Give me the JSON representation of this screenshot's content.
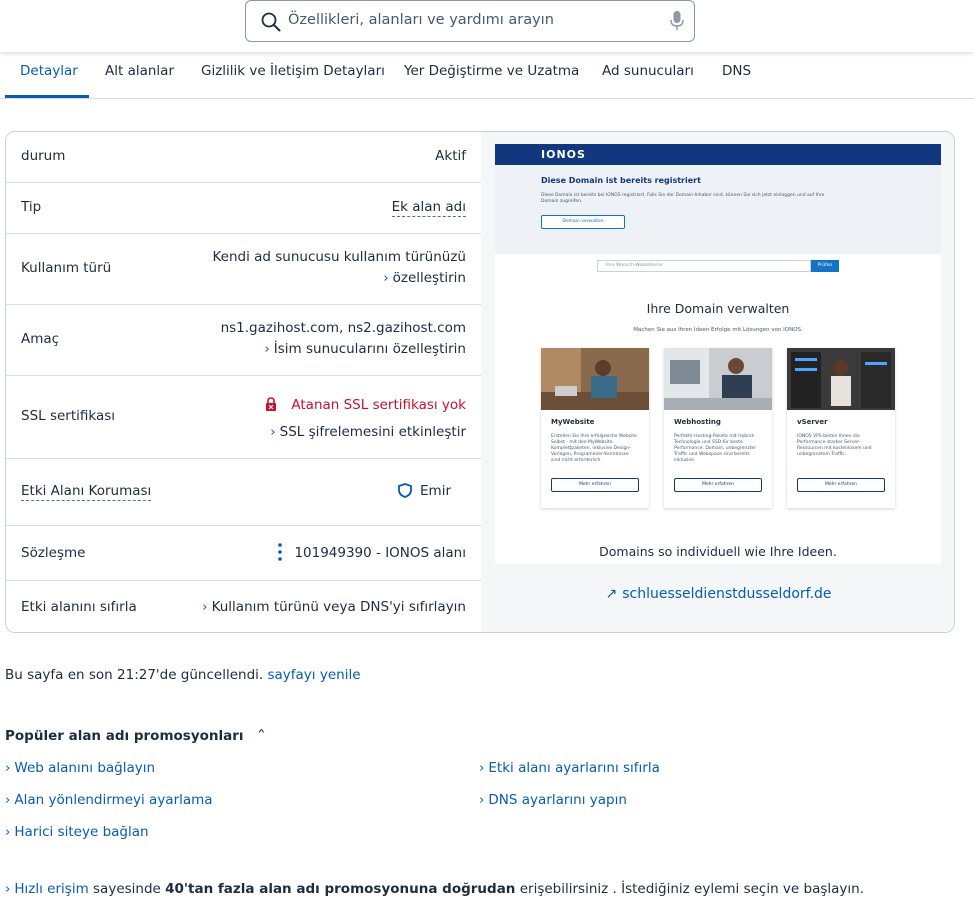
{
  "search": {
    "placeholder": "Özellikleri, alanları ve yardımı arayın"
  },
  "tabs": [
    {
      "label": "Detaylar"
    },
    {
      "label": "Alt alanlar"
    },
    {
      "label": "Gizlilik ve İletişim Detayları"
    },
    {
      "label": "Yer Değiştirme ve Uzatma"
    },
    {
      "label": "Ad sunucuları"
    },
    {
      "label": "DNS"
    }
  ],
  "details": {
    "status": {
      "label": "durum",
      "value": "Aktif"
    },
    "type": {
      "label": "Tip",
      "value": "Ek alan adı"
    },
    "usage": {
      "label": "Kullanım türü",
      "value": "Kendi ad sunucusu kullanım türünüzü",
      "link": "özelleştirin"
    },
    "purpose": {
      "label": "Amaç",
      "value": "ns1.gazihost.com, ns2.gazihost.com",
      "link": "İsim sunucularını özelleştirin"
    },
    "ssl": {
      "label": "SSL sertifikası",
      "value": "Atanan SSL sertifikası yok",
      "link": "SSL şifrelemesini etkinleştir"
    },
    "protection": {
      "label": "Etki Alanı Koruması",
      "link": "Emir"
    },
    "contract": {
      "label": "Sözleşme",
      "value": "101949390 - IONOS alanı"
    },
    "reset": {
      "label": "Etki alanını sıfırla",
      "link": "Kullanım türünü veya DNS'yi sıfırlayın"
    }
  },
  "preview": {
    "logo": "IONOS",
    "heading": "Diese Domain ist bereits registriert",
    "small_text": "Diese Domain ist bereits bei IONOS registriert. Falls Sie der Domain-Inhaber sind, können Sie sich jetzt einloggen und auf Ihre Domain zugreifen.",
    "manage_button": "Domain verwalten",
    "search_placeholder": "Ihre Wunsch-Webadresse",
    "search_button": "Prüfen",
    "title": "Ihre Domain verwalten",
    "subtitle": "Machen Sie aus Ihren Ideen Erfolge mit Lösungen von IONOS.",
    "cards": [
      {
        "title": "MyWebsite",
        "text": "Erstellen Sie Ihre erfolgreiche Website Selbst - mit den MyWebsite Komplettpaketen, inklusive Design-Vorlagen, Programmier-Kenntnisse sind nicht erforderlich.",
        "button": "Mehr erfahren"
      },
      {
        "title": "Webhosting",
        "text": "Perfekte Hosting-Pakete mit Hybrid-Technologie und SSD für beste Performance. Domain, unbegrenzter Traffic und Webspace sind bereits inklusive.",
        "button": "Mehr erfahren"
      },
      {
        "title": "vServer",
        "text": "IONOS VPS bieten Ihnen die Performance starker Server-Ressourcen mit kostenlosem und unbegrenztem Traffic.",
        "button": "Mehr erfahren"
      }
    ],
    "footer": "Domains so individuell wie Ihre Ideen."
  },
  "site_link": "schluesseldienstdusseldorf.de",
  "updated": {
    "text": "Bu sayfa en son 21:27'de güncellendi.",
    "link": "sayfayı yenile"
  },
  "promos": {
    "title": "Popüler alan adı promosyonları",
    "items": [
      "Web alanını bağlayın",
      "Etki alanı ayarlarını sıfırla",
      "Alan yönlendirmeyi ayarlama",
      "DNS ayarlarını yapın",
      "Harici siteye bağlan"
    ]
  },
  "quick_access": {
    "link": "Hızlı erişim",
    "text1": " sayesinde ",
    "bold": "40'tan fazla alan adı promosyonuna doğrudan",
    "text2": " erişebilirsiniz . İstediğiniz eylemi seçin ve başlayın."
  },
  "colors": {
    "accent": "#095bb1",
    "error": "#c8102e",
    "brand": "#11387f"
  }
}
